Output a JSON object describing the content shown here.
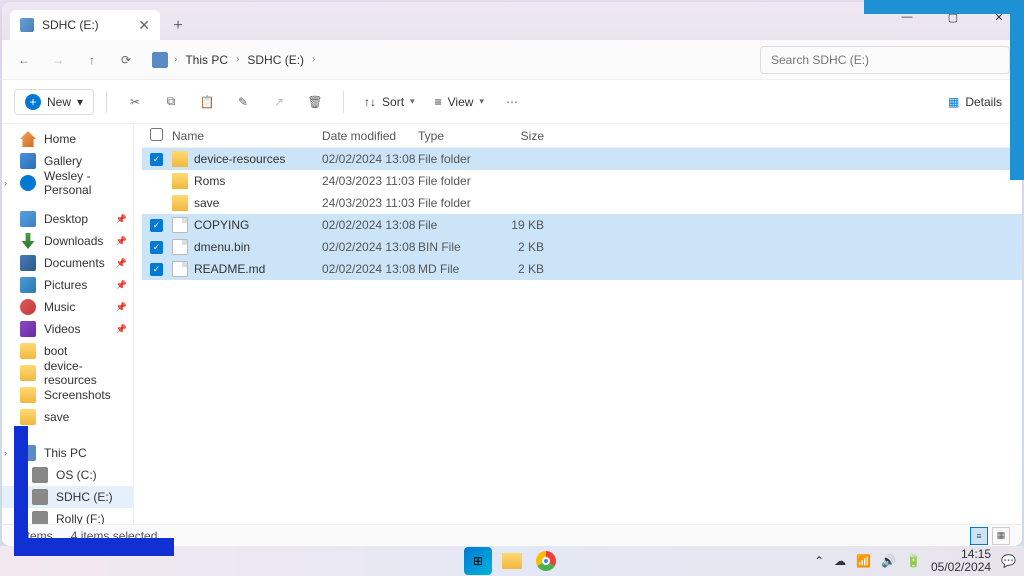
{
  "tab": {
    "title": "SDHC (E:)"
  },
  "window": {
    "min": "—",
    "max": "▢",
    "close": "✕"
  },
  "nav": {
    "back": "←",
    "forward": "→",
    "up": "↑",
    "refresh": "⟳",
    "breadcrumb": [
      "This PC",
      "SDHC (E:)"
    ]
  },
  "search": {
    "placeholder": "Search SDHC (E:)"
  },
  "toolbar": {
    "new": "New",
    "sort": "Sort",
    "view": "View",
    "details": "Details"
  },
  "sidebar": {
    "qa": [
      {
        "label": "Home",
        "icon": "i-home"
      },
      {
        "label": "Gallery",
        "icon": "i-gallery"
      },
      {
        "label": "Wesley - Personal",
        "icon": "i-cloud",
        "expand": true
      }
    ],
    "pinned": [
      {
        "label": "Desktop",
        "icon": "i-desktop",
        "pin": true
      },
      {
        "label": "Downloads",
        "icon": "i-down",
        "pin": true
      },
      {
        "label": "Documents",
        "icon": "i-docs",
        "pin": true
      },
      {
        "label": "Pictures",
        "icon": "i-pics",
        "pin": true
      },
      {
        "label": "Music",
        "icon": "i-music",
        "pin": true
      },
      {
        "label": "Videos",
        "icon": "i-video",
        "pin": true
      },
      {
        "label": "boot",
        "icon": "i-folder"
      },
      {
        "label": "device-resources",
        "icon": "i-folder"
      },
      {
        "label": "Screenshots",
        "icon": "i-folder"
      },
      {
        "label": "save",
        "icon": "i-folder"
      }
    ],
    "drives": [
      {
        "label": "This PC",
        "icon": "i-pc",
        "expand": true
      },
      {
        "label": "OS (C:)",
        "icon": "i-drive",
        "indent": true
      },
      {
        "label": "SDHC (E:)",
        "icon": "i-drive",
        "indent": true,
        "selected": true
      },
      {
        "label": "Rolly (F:)",
        "icon": "i-drive",
        "indent": true
      },
      {
        "label": "Rolly (F:)",
        "icon": "i-drive"
      }
    ]
  },
  "columns": {
    "name": "Name",
    "date": "Date modified",
    "type": "Type",
    "size": "Size"
  },
  "files": [
    {
      "sel": true,
      "icon": "i-folder",
      "name": "device-resources",
      "date": "02/02/2024 13:08",
      "type": "File folder",
      "size": ""
    },
    {
      "sel": false,
      "icon": "i-folder",
      "name": "Roms",
      "date": "24/03/2023 11:03",
      "type": "File folder",
      "size": ""
    },
    {
      "sel": false,
      "icon": "i-folder",
      "name": "save",
      "date": "24/03/2023 11:03",
      "type": "File folder",
      "size": ""
    },
    {
      "sel": true,
      "icon": "i-file",
      "name": "COPYING",
      "date": "02/02/2024 13:08",
      "type": "File",
      "size": "19 KB"
    },
    {
      "sel": true,
      "icon": "i-file",
      "name": "dmenu.bin",
      "date": "02/02/2024 13:08",
      "type": "BIN File",
      "size": "2 KB"
    },
    {
      "sel": true,
      "icon": "i-file",
      "name": "README.md",
      "date": "02/02/2024 13:08",
      "type": "MD File",
      "size": "2 KB"
    }
  ],
  "status": {
    "count": "6 items",
    "selected": "4 items selected"
  },
  "tray": {
    "time": "14:15",
    "date": "05/02/2024"
  }
}
